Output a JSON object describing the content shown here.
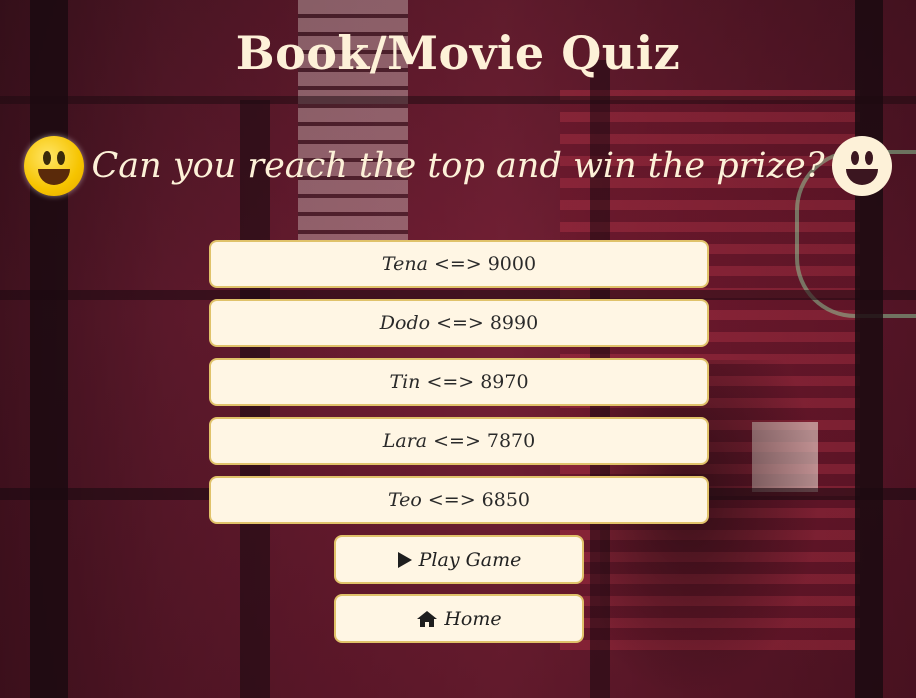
{
  "page": {
    "title": "Book/Movie Quiz",
    "subtitle": "Can you reach the top and win the prize?"
  },
  "icons": {
    "left": "smiley-face-icon",
    "right": "smiley-face-icon"
  },
  "leaderboard": [
    {
      "name": "Tena",
      "separator": "<=>",
      "score": "9000"
    },
    {
      "name": "Dodo",
      "separator": "<=>",
      "score": "8990"
    },
    {
      "name": "Tin",
      "separator": "<=>",
      "score": "8970"
    },
    {
      "name": "Lara",
      "separator": "<=>",
      "score": "7870"
    },
    {
      "name": "Teo",
      "separator": "<=>",
      "score": "6850"
    }
  ],
  "buttons": {
    "play": {
      "label": "Play Game",
      "icon": "play-icon"
    },
    "home": {
      "label": "Home",
      "icon": "home-icon"
    }
  },
  "colors": {
    "text_light": "#fdf1d8",
    "button_bg": "#fff6e4",
    "button_border": "#e0c26a"
  }
}
